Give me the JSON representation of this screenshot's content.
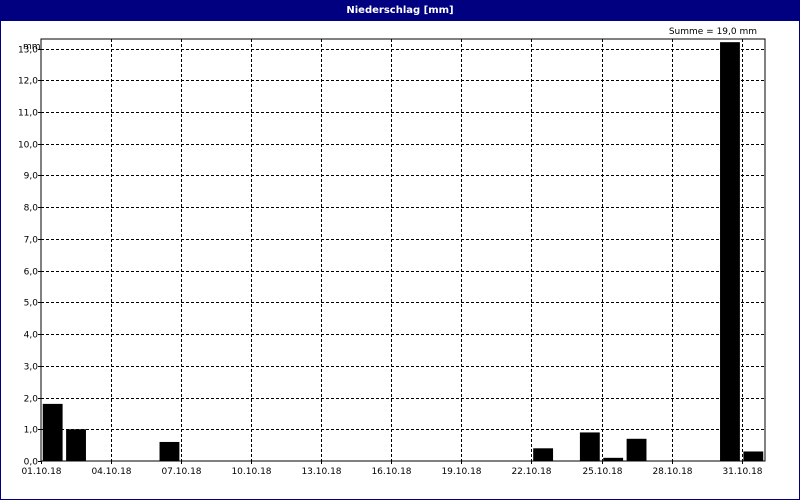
{
  "title": "Niederschlag [mm]",
  "summary": "Summe = 19,0 mm",
  "chart_data": {
    "type": "bar",
    "title": "Niederschlag [mm]",
    "ylabel": "mm",
    "xlabel": "",
    "ylim": [
      0,
      13.3
    ],
    "grid": true,
    "yticks": [
      "0,0",
      "1,0",
      "2,0",
      "3,0",
      "4,0",
      "5,0",
      "6,0",
      "7,0",
      "8,0",
      "9,0",
      "10,0",
      "11,0",
      "12,0",
      "13,0"
    ],
    "xticks": [
      "01.10.18",
      "04.10.18",
      "07.10.18",
      "10.10.18",
      "13.10.18",
      "16.10.18",
      "19.10.18",
      "22.10.18",
      "25.10.18",
      "28.10.18",
      "31.10.18"
    ],
    "categories": [
      "01.10.18",
      "02.10.18",
      "03.10.18",
      "04.10.18",
      "05.10.18",
      "06.10.18",
      "07.10.18",
      "08.10.18",
      "09.10.18",
      "10.10.18",
      "11.10.18",
      "12.10.18",
      "13.10.18",
      "14.10.18",
      "15.10.18",
      "16.10.18",
      "17.10.18",
      "18.10.18",
      "19.10.18",
      "20.10.18",
      "21.10.18",
      "22.10.18",
      "23.10.18",
      "24.10.18",
      "25.10.18",
      "26.10.18",
      "27.10.18",
      "28.10.18",
      "29.10.18",
      "30.10.18",
      "31.10.18"
    ],
    "values": [
      1.8,
      1.0,
      0,
      0,
      0,
      0.6,
      0,
      0,
      0,
      0,
      0,
      0,
      0,
      0,
      0,
      0,
      0,
      0,
      0,
      0,
      0,
      0.4,
      0,
      0.9,
      0.1,
      0.7,
      0,
      0,
      0,
      13.2,
      0.3
    ],
    "colors": {
      "bar": "#000000",
      "grid": "#000000",
      "title_bg": "#000080"
    }
  }
}
